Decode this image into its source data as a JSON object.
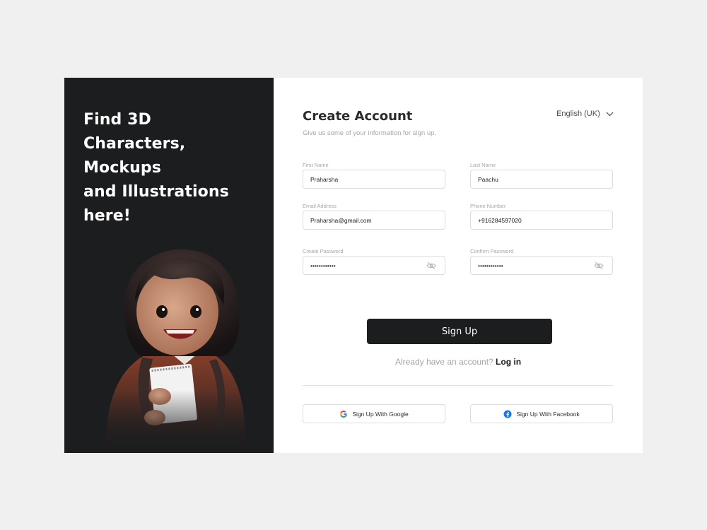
{
  "promo": {
    "headline_lines": [
      "Find 3D",
      "Characters,",
      "Mockups",
      "and Illustrations",
      "here!"
    ]
  },
  "form": {
    "title": "Create Account",
    "subtitle": "Give us some of your information for sign up.",
    "language": "English (UK)",
    "fields": {
      "first_name": {
        "label": "First Name",
        "value": "Praharsha"
      },
      "last_name": {
        "label": "Last Name",
        "value": "Paachu"
      },
      "email": {
        "label": "Email Address",
        "value": "Praharsha@gmail.com"
      },
      "phone": {
        "label": "Phone Number",
        "value": "+916284597020"
      },
      "password": {
        "label": "Create Password",
        "value": "••••••••••••"
      },
      "confirm_password": {
        "label": "Confirm Password",
        "value": "••••••••••••"
      }
    },
    "signup_label": "Sign Up",
    "login_prompt": "Already have an account?",
    "login_link": "Log in",
    "google_label": "Sign Up With Google",
    "facebook_label": "Sign Up With Facebook"
  },
  "colors": {
    "panel_dark": "#1c1d1f",
    "facebook_blue": "#1877f2"
  },
  "icons": {
    "language_dropdown": "chevron-down-icon",
    "password_toggle": "eye-slash-icon",
    "google": "google-icon",
    "facebook": "facebook-icon"
  }
}
